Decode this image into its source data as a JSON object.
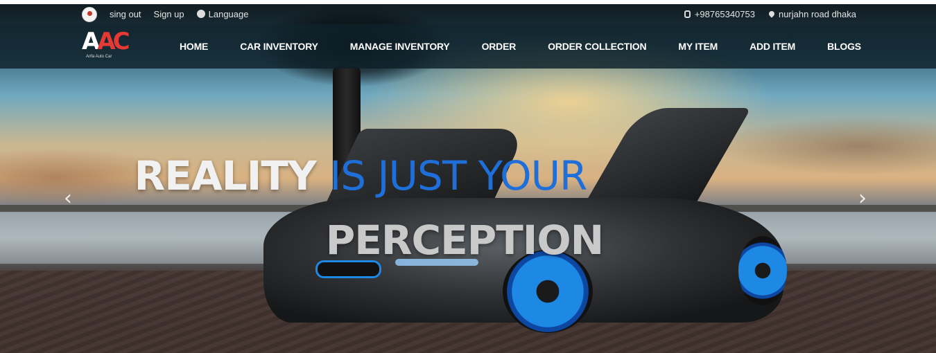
{
  "topbar": {
    "sign_out": "sing out",
    "sign_up": "Sign up",
    "language": "Language",
    "phone": "+98765340753",
    "address": "nurjahn road dhaka"
  },
  "brand": {
    "logo_letters_a": "A",
    "logo_letters_b": "AC",
    "logo_subtitle": "Arifa Auto Car",
    "accent_red": "#e53935"
  },
  "nav": {
    "items": [
      {
        "label": "HOME"
      },
      {
        "label": "CAR INVENTORY"
      },
      {
        "label": "MANAGE INVENTORY"
      },
      {
        "label": "ORDER"
      },
      {
        "label": "ORDER COLLECTION"
      },
      {
        "label": "MY ITEM"
      },
      {
        "label": "ADD ITEM"
      },
      {
        "label": "BLOGS"
      }
    ]
  },
  "hero": {
    "headline_white": "REALITY ",
    "headline_blue": "IS JUST YOUR",
    "headline_line2": "PERCEPTION",
    "accent_blue": "#1e6fd9",
    "prev_glyph": "‹",
    "next_glyph": "›"
  }
}
